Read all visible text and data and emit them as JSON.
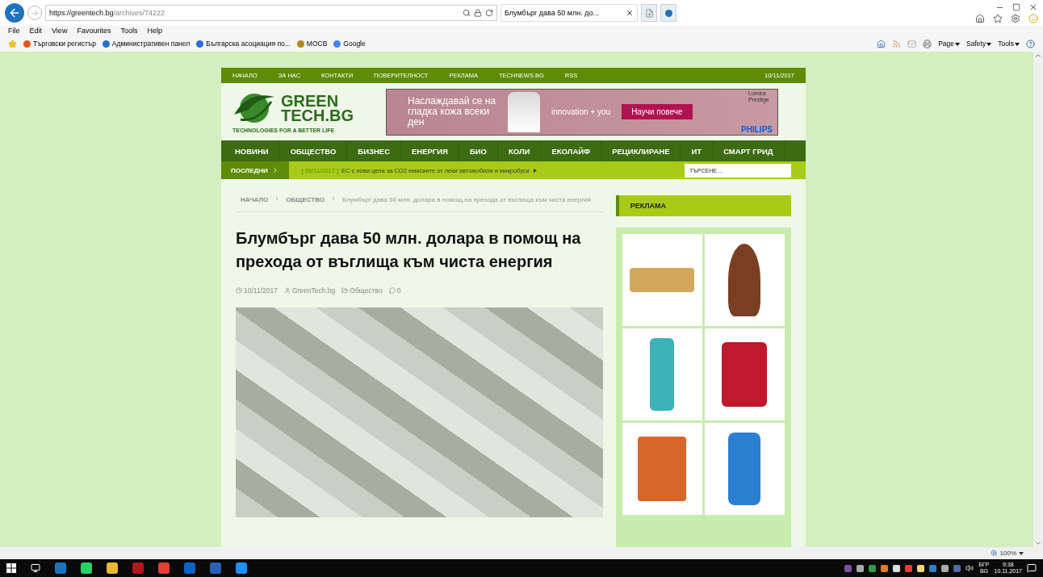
{
  "browser": {
    "url_host": "https://greentech.bg",
    "url_path": "/archives/74222",
    "tab_title": "Блумбърг дава 50 млн. до...",
    "menu": [
      "File",
      "Edit",
      "View",
      "Favourites",
      "Tools",
      "Help"
    ],
    "favorites": [
      {
        "label": "Търговски регистър"
      },
      {
        "label": "Административен панел"
      },
      {
        "label": "Българска асоциация по..."
      },
      {
        "label": "МОСВ"
      },
      {
        "label": "Google"
      }
    ],
    "commands": [
      "Page",
      "Safety",
      "Tools"
    ],
    "zoom": "100%"
  },
  "site": {
    "top_nav": [
      "НАЧАЛО",
      "ЗА НАС",
      "КОНТАКТИ",
      "ПОВЕРИТЕЛНОСТ",
      "РЕКЛАМА",
      "TECHNEWS.BG",
      "RSS"
    ],
    "date": "10/11/2017",
    "logo": {
      "line1": "GREEN",
      "line2": "TECH.BG",
      "tagline": "TECHNOLOGIES FOR A BETTER LIFE"
    },
    "banner": {
      "text": "Наслаждавай се на гладка кожа всеки ден",
      "slogan": "innovation + you",
      "button": "Научи повече",
      "badge": "Lumea Prestige",
      "brand": "PHILIPS"
    },
    "main_nav": [
      "НОВИНИ",
      "ОБЩЕСТВО",
      "БИЗНЕС",
      "ЕНЕРГИЯ",
      "БИО",
      "КОЛИ",
      "ЕКОЛАЙФ",
      "РЕЦИКЛИРАНЕ",
      "ИТ",
      "СМАРТ ГРИД"
    ],
    "ticker": {
      "label": "ПОСЛЕДНИ",
      "date": "[ 09/11/2017 ]",
      "headline": "ЕС с нови цели за CO2 емисиите от леки автомобили и микробуси"
    },
    "search": {
      "placeholder": "ТЪРСЕНЕ ..."
    },
    "breadcrumb": [
      "НАЧАЛО",
      "ОБЩЕСТВО",
      "Блумбърг дава 50 млн. долара в помощ на прехода от въглища към чиста енергия"
    ],
    "title": "Блумбърг дава 50 млн. долара в помощ на прехода от въглища към чиста енергия",
    "meta": {
      "date": "10/11/2017",
      "author": "GreenTech.bg",
      "category": "Общество",
      "comments": "0"
    },
    "sidebar": {
      "heading": "РЕКЛАМА"
    }
  },
  "taskbar": {
    "language": "БГР",
    "locale": "BG",
    "time": "9:38",
    "date": "10.11.2017"
  }
}
